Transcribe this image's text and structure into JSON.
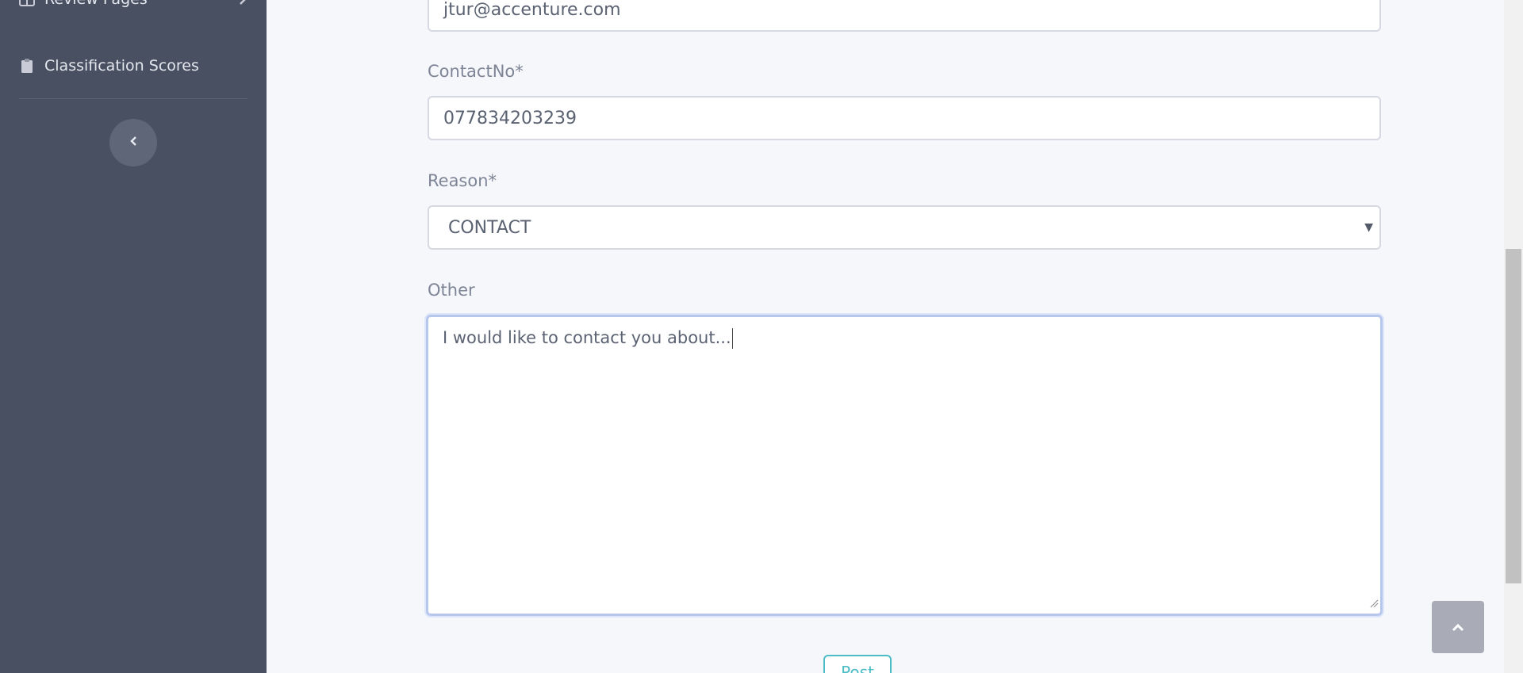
{
  "sidebar": {
    "review_pages_label": "Review Pages",
    "classification_scores_label": "Classification Scores",
    "icons": {
      "review": "table-icon",
      "scores": "clipboard-icon",
      "collapse": "chevron-left-icon"
    }
  },
  "form": {
    "email_value": "jtur@accenture.com",
    "contact_label": "ContactNo*",
    "contact_value": "077834203239",
    "reason_label": "Reason*",
    "reason_value": "CONTACT",
    "other_label": "Other",
    "other_value": "I would like to contact you about...",
    "post_button_label": "Post"
  },
  "colors": {
    "sidebar_bg": "#495061",
    "page_bg": "#f6f7fb",
    "accent": "#4cbcc6",
    "focus_border": "#b7c7ec"
  }
}
